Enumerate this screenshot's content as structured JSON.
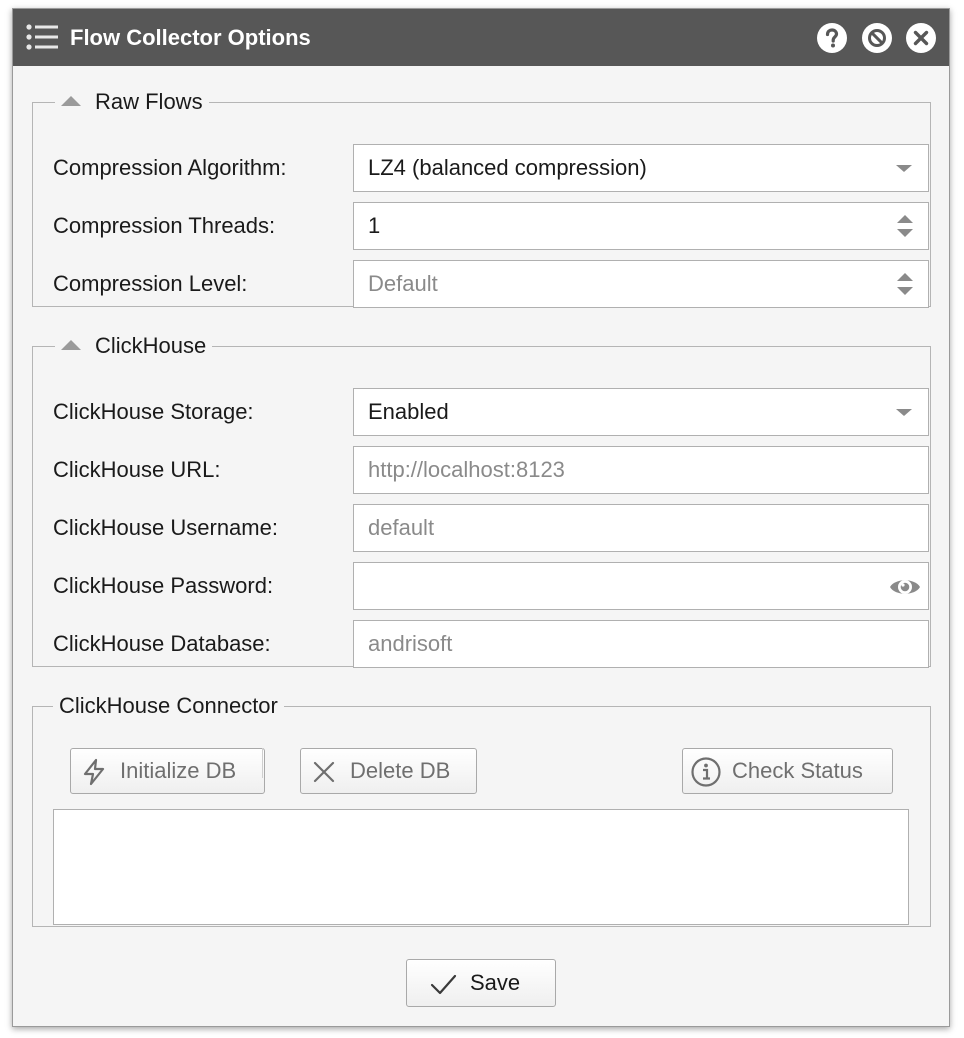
{
  "window": {
    "title": "Flow Collector Options",
    "help_icon": "question-circle-icon",
    "minimize_icon": "ban-circle-icon",
    "close_icon": "close-circle-icon",
    "menu_icon": "list-menu-icon"
  },
  "raw_flows": {
    "legend": "Raw Flows",
    "compression_algorithm": {
      "label": "Compression Algorithm:",
      "value": "LZ4 (balanced compression)"
    },
    "compression_threads": {
      "label": "Compression Threads:",
      "value": "1"
    },
    "compression_level": {
      "label": "Compression Level:",
      "placeholder": "Default"
    }
  },
  "clickhouse": {
    "legend": "ClickHouse",
    "storage": {
      "label": "ClickHouse Storage:",
      "value": "Enabled"
    },
    "url": {
      "label": "ClickHouse URL:",
      "placeholder": "http://localhost:8123"
    },
    "username": {
      "label": "ClickHouse Username:",
      "placeholder": "default"
    },
    "password": {
      "label": "ClickHouse Password:",
      "value": "",
      "toggle_icon": "eye-icon"
    },
    "database": {
      "label": "ClickHouse Database:",
      "placeholder": "andrisoft"
    }
  },
  "connector": {
    "legend": "ClickHouse Connector",
    "initialize_label": "Initialize DB",
    "delete_label": "Delete DB",
    "check_status_label": "Check Status",
    "output_text": ""
  },
  "footer": {
    "save_label": "Save"
  }
}
